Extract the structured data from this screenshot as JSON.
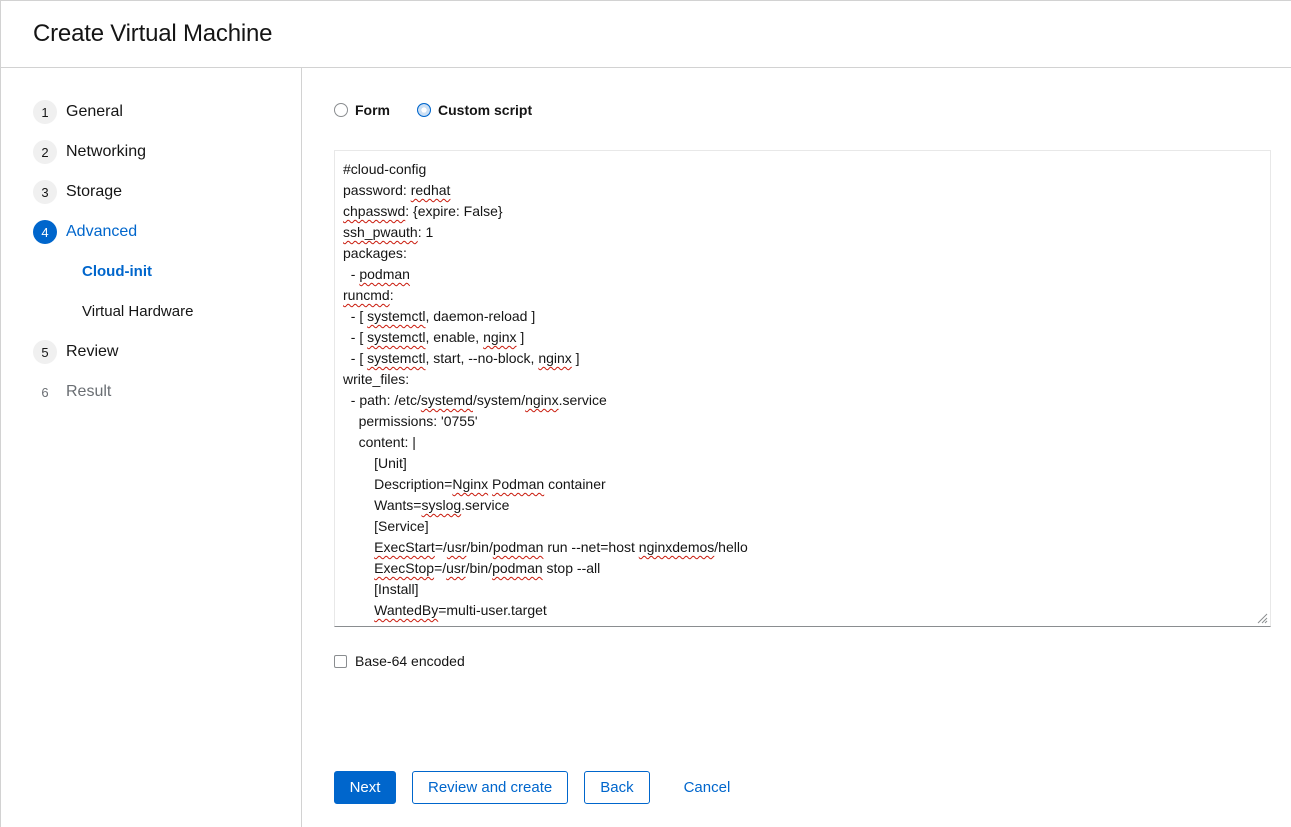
{
  "header": {
    "title": "Create Virtual Machine"
  },
  "nav": {
    "steps": [
      {
        "num": "1",
        "label": "General"
      },
      {
        "num": "2",
        "label": "Networking"
      },
      {
        "num": "3",
        "label": "Storage"
      },
      {
        "num": "4",
        "label": "Advanced"
      },
      {
        "num": "5",
        "label": "Review"
      },
      {
        "num": "6",
        "label": "Result"
      }
    ],
    "substeps": [
      {
        "label": "Cloud-init"
      },
      {
        "label": "Virtual Hardware"
      }
    ]
  },
  "mode": {
    "form_label": "Form",
    "script_label": "Custom script",
    "selected": "Custom script"
  },
  "editor": {
    "lines": [
      "#cloud-config",
      "password: redhat",
      "chpasswd: {expire: False}",
      "ssh_pwauth: 1",
      "packages:",
      "  - podman",
      "runcmd:",
      "  - [ systemctl, daemon-reload ]",
      "  - [ systemctl, enable, nginx ]",
      "  - [ systemctl, start, --no-block, nginx ]",
      "write_files:",
      "  - path: /etc/systemd/system/nginx.service",
      "    permissions: '0755'",
      "    content: |",
      "        [Unit]",
      "        Description=Nginx Podman container",
      "        Wants=syslog.service",
      "        [Service]",
      "        ExecStart=/usr/bin/podman run --net=host nginxdemos/hello",
      "        ExecStop=/usr/bin/podman stop --all",
      "        [Install]",
      "        WantedBy=multi-user.target"
    ],
    "misspelled": [
      "redhat",
      "chpasswd",
      "ssh_pwauth",
      "podman",
      "runcmd",
      "systemctl",
      "nginx",
      "systemd",
      "Nginx",
      "Podman",
      "syslog",
      "ExecStart",
      "usr",
      "nginxdemos",
      "ExecStop",
      "WantedBy"
    ]
  },
  "base64": {
    "label": "Base-64 encoded",
    "checked": false
  },
  "footer": {
    "next_label": "Next",
    "review_label": "Review and create",
    "back_label": "Back",
    "cancel_label": "Cancel"
  },
  "colors": {
    "accent": "#0066cc",
    "spell_error": "#c9190b",
    "border": "#d2d2d2"
  }
}
